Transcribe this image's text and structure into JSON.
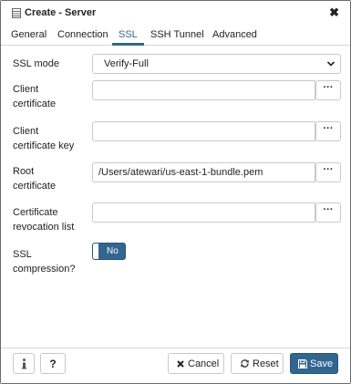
{
  "dialog": {
    "title": "Create - Server",
    "title_icon": "server-icon",
    "close_glyph": "✖"
  },
  "tabs": [
    {
      "label": "General",
      "active": false
    },
    {
      "label": "Connection",
      "active": false
    },
    {
      "label": "SSL",
      "active": true
    },
    {
      "label": "SSH Tunnel",
      "active": false
    },
    {
      "label": "Advanced",
      "active": false
    }
  ],
  "form": {
    "ssl_mode": {
      "label": "SSL mode",
      "value": "Verify-Full"
    },
    "client_certificate": {
      "label": "Client\ncertificate",
      "value": "",
      "browse_label": "···"
    },
    "client_certificate_key": {
      "label": "Client\ncertificate key",
      "value": "",
      "browse_label": "···"
    },
    "root_certificate": {
      "label": "Root\ncertificate",
      "value": "/Users/atewari/us-east-1-bundle.pem",
      "browse_label": "···"
    },
    "certificate_revocation_list": {
      "label": "Certificate\nrevocation list",
      "value": "",
      "browse_label": "···"
    },
    "ssl_compression": {
      "label": "SSL\ncompression?",
      "toggle_label": "No",
      "enabled": false
    }
  },
  "footer": {
    "info_icon": "info-icon",
    "help_label": "?",
    "cancel_label": "Cancel",
    "reset_label": "Reset",
    "save_label": "Save"
  },
  "colors": {
    "accent": "#326690",
    "border": "#c9c9c9",
    "text": "#222222"
  }
}
